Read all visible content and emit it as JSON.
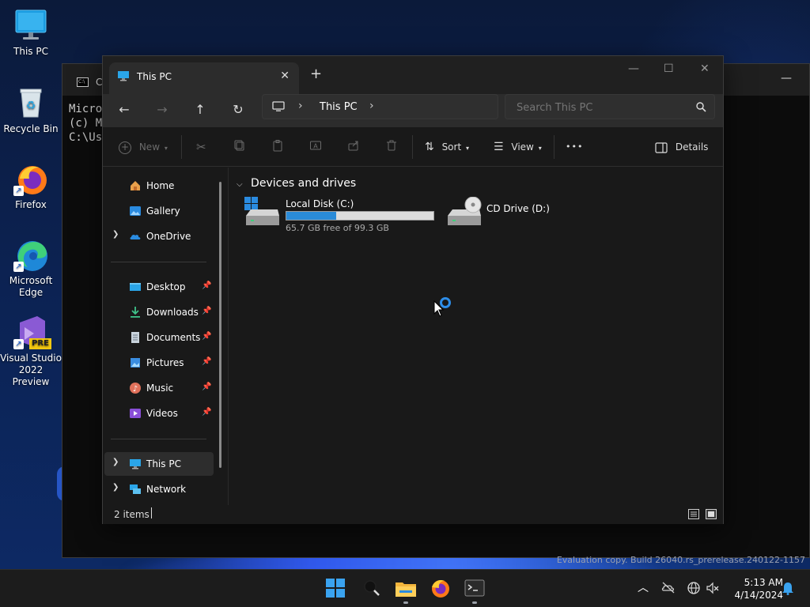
{
  "desktop": {
    "icons": [
      {
        "label": "This PC",
        "icon": "monitor-icon"
      },
      {
        "label": "Recycle Bin",
        "icon": "recycle-bin-icon"
      },
      {
        "label": "Firefox",
        "icon": "firefox-icon"
      },
      {
        "label": "Microsoft Edge",
        "icon": "edge-icon"
      },
      {
        "label": "Visual Studio 2022 Preview",
        "icon": "visual-studio-icon",
        "badge": "PRE"
      }
    ],
    "evaluation_text": "Evaluation copy. Build 26040.rs_prerelease.240122-1157"
  },
  "terminal": {
    "tab_title": "C",
    "lines": [
      "Micro",
      "(c) M",
      "",
      "C:\\Us"
    ],
    "minimize_glyph": "—"
  },
  "explorer": {
    "tab": {
      "title": "This PC",
      "close_glyph": "✕"
    },
    "new_tab_glyph": "+",
    "window_buttons": {
      "minimize": "—",
      "maximize": "☐",
      "close": "✕"
    },
    "nav": {
      "back": "←",
      "forward": "→",
      "up": "↑",
      "refresh": "↻"
    },
    "address": {
      "location": "This PC",
      "separator": "›"
    },
    "search": {
      "placeholder": "Search This PC"
    },
    "toolbar": {
      "new_label": "New",
      "sort_label": "Sort",
      "view_label": "View",
      "more_glyph": "•••",
      "details_label": "Details"
    },
    "sidebar": {
      "items": [
        {
          "label": "Home",
          "icon": "home-icon"
        },
        {
          "label": "Gallery",
          "icon": "gallery-icon"
        },
        {
          "label": "OneDrive",
          "icon": "onedrive-icon",
          "expandable": true
        },
        {
          "label": "Desktop",
          "icon": "desktop-folder-icon",
          "pinned": true
        },
        {
          "label": "Downloads",
          "icon": "downloads-icon",
          "pinned": true
        },
        {
          "label": "Documents",
          "icon": "documents-icon",
          "pinned": true
        },
        {
          "label": "Pictures",
          "icon": "pictures-icon",
          "pinned": true
        },
        {
          "label": "Music",
          "icon": "music-icon",
          "pinned": true
        },
        {
          "label": "Videos",
          "icon": "videos-icon",
          "pinned": true
        },
        {
          "label": "This PC",
          "icon": "monitor-icon",
          "expandable": true,
          "selected": true
        },
        {
          "label": "Network",
          "icon": "network-icon",
          "expandable": true
        }
      ]
    },
    "content": {
      "group_header": "Devices and drives",
      "drives": [
        {
          "label": "Local Disk (C:)",
          "free_text": "65.7 GB free of 99.3 GB",
          "used_fraction": 0.338,
          "icon": "hard-drive-icon"
        },
        {
          "label": "CD Drive (D:)",
          "icon": "cd-drive-icon"
        }
      ]
    },
    "status": {
      "items_text": "2 items"
    }
  },
  "taskbar": {
    "apps": [
      "start-icon",
      "search-icon",
      "file-explorer-icon",
      "firefox-icon",
      "terminal-icon"
    ],
    "clock": {
      "time": "5:13 AM",
      "date": "4/14/2024"
    }
  },
  "colors": {
    "accent": "#2a8bd8",
    "explorer_bg": "#191919",
    "titlebar_bg": "#202020",
    "taskbar_bg": "#1c1c1c"
  }
}
